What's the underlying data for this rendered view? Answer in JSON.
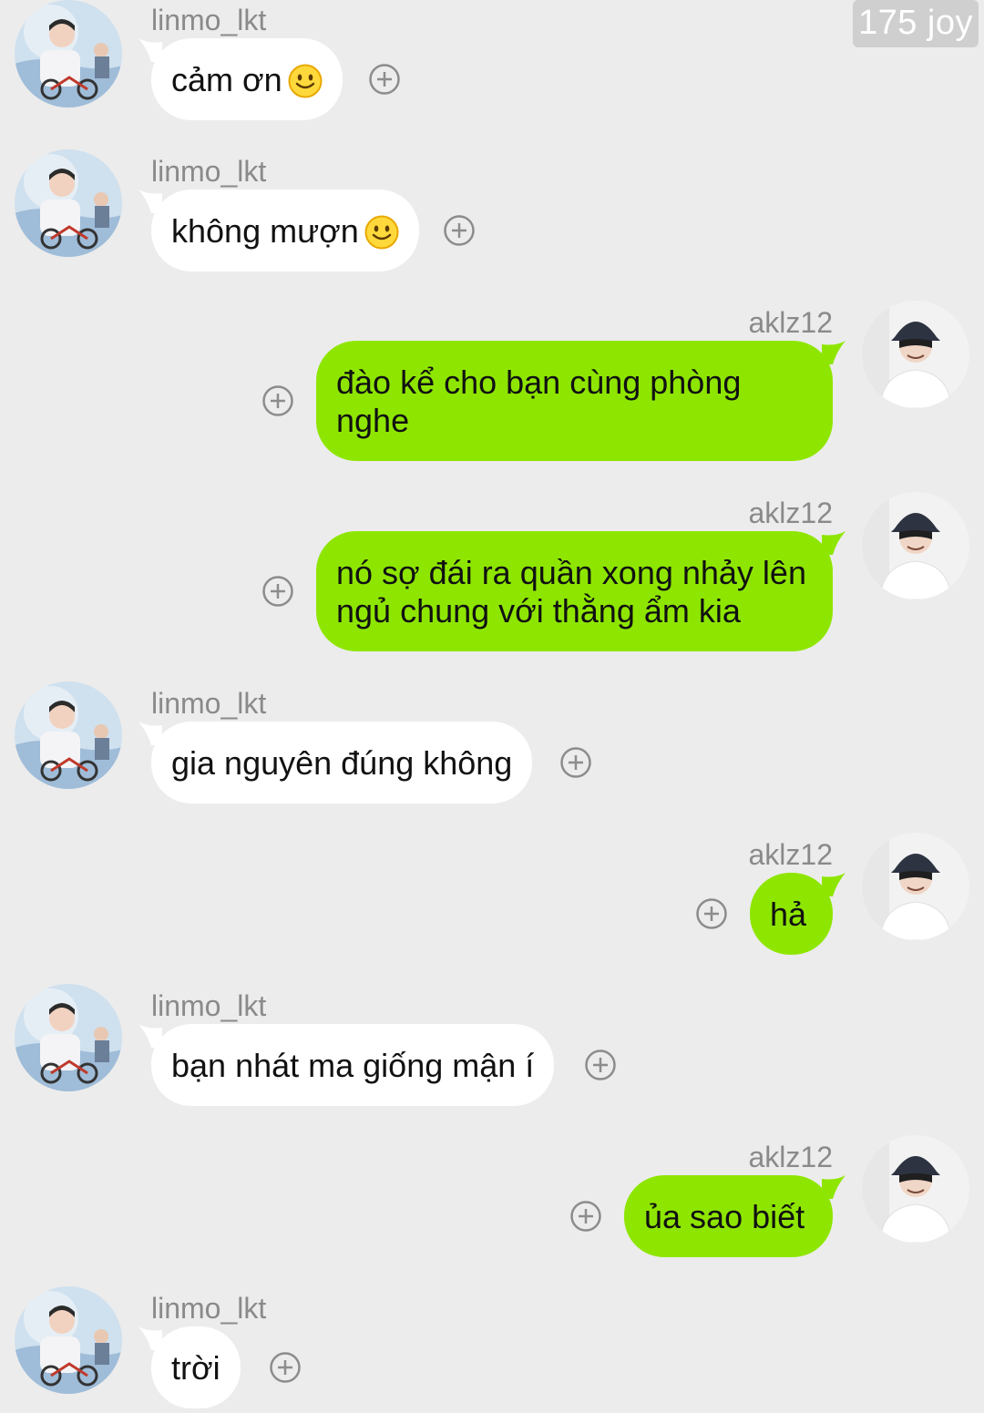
{
  "watermark": "175 joy",
  "users": {
    "left": "linmo_lkt",
    "right": "aklz12"
  },
  "colors": {
    "background": "#ececec",
    "incoming_bubble": "#ffffff",
    "outgoing_bubble": "#8ee600",
    "username": "#8a8a8a"
  },
  "messages": [
    {
      "side": "left",
      "user": "linmo_lkt",
      "text": "cảm ơn",
      "emoji": "smile-emoji"
    },
    {
      "side": "left",
      "user": "linmo_lkt",
      "text": "không mượn",
      "emoji": "smile-emoji"
    },
    {
      "side": "right",
      "user": "aklz12",
      "line1": "đào kể cho bạn cùng phòng",
      "line2": "nghe"
    },
    {
      "side": "right",
      "user": "aklz12",
      "line1": "nó sợ đái ra quần xong nhảy lên",
      "line2": "ngủ chung với thằng ẩm kia"
    },
    {
      "side": "left",
      "user": "linmo_lkt",
      "text": "gia nguyên đúng không"
    },
    {
      "side": "right",
      "user": "aklz12",
      "text": "hả"
    },
    {
      "side": "left",
      "user": "linmo_lkt",
      "text": "bạn nhát ma giống mận í"
    },
    {
      "side": "right",
      "user": "aklz12",
      "text": "ủa sao biết"
    },
    {
      "side": "left",
      "user": "linmo_lkt",
      "text": "trời"
    }
  ],
  "icons": {
    "add_reaction": "plus-circle-icon",
    "avatar_left": "avatar-linmo",
    "avatar_right": "avatar-aklz12"
  }
}
